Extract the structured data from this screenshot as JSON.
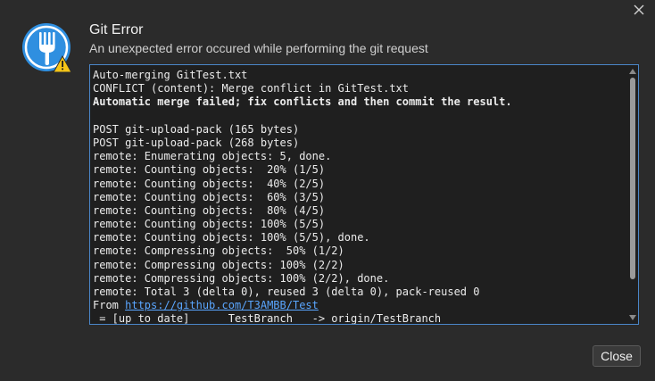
{
  "dialog": {
    "title": "Git Error",
    "subtitle": "An unexpected error occured while performing the git request",
    "close_button_label": "Close",
    "close_icon": "close-icon",
    "app_icon": "fork-warning-icon"
  },
  "log": {
    "lines": [
      {
        "text": "Auto-merging GitTest.txt",
        "bold": false
      },
      {
        "text": "CONFLICT (content): Merge conflict in GitTest.txt",
        "bold": false
      },
      {
        "text": "Automatic merge failed; fix conflicts and then commit the result.",
        "bold": true
      },
      {
        "text": "",
        "bold": false
      },
      {
        "text": "POST git-upload-pack (165 bytes)",
        "bold": false
      },
      {
        "text": "POST git-upload-pack (268 bytes)",
        "bold": false
      },
      {
        "text": "remote: Enumerating objects: 5, done.",
        "bold": false
      },
      {
        "text": "remote: Counting objects:  20% (1/5)",
        "bold": false
      },
      {
        "text": "remote: Counting objects:  40% (2/5)",
        "bold": false
      },
      {
        "text": "remote: Counting objects:  60% (3/5)",
        "bold": false
      },
      {
        "text": "remote: Counting objects:  80% (4/5)",
        "bold": false
      },
      {
        "text": "remote: Counting objects: 100% (5/5)",
        "bold": false
      },
      {
        "text": "remote: Counting objects: 100% (5/5), done.",
        "bold": false
      },
      {
        "text": "remote: Compressing objects:  50% (1/2)",
        "bold": false
      },
      {
        "text": "remote: Compressing objects: 100% (2/2)",
        "bold": false
      },
      {
        "text": "remote: Compressing objects: 100% (2/2), done.",
        "bold": false
      },
      {
        "text": "remote: Total 3 (delta 0), reused 3 (delta 0), pack-reused 0",
        "bold": false
      }
    ],
    "from_prefix": "From ",
    "from_link": "https://github.com/T3AMBB/Test",
    "partial_line": " = [up to date]      TestBranch   -> origin/TestBranch"
  },
  "colors": {
    "background": "#2b2b2b",
    "log_background": "#1f1f1f",
    "log_border": "#4a86c8",
    "link": "#5aa6ff",
    "icon_blue": "#2f8fe0",
    "warning_yellow": "#f5c518"
  }
}
